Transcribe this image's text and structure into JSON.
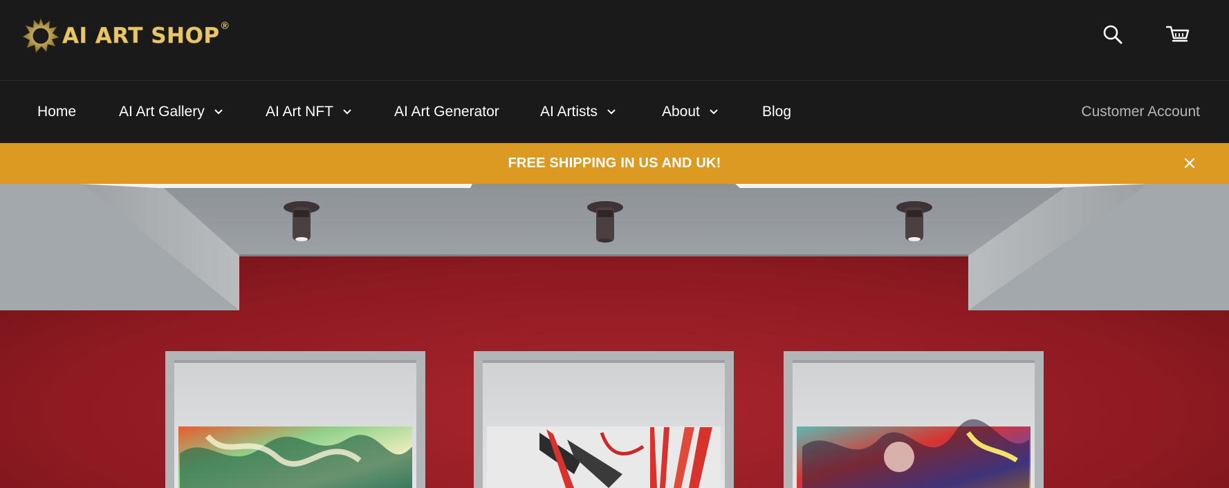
{
  "brand": {
    "name": "AI ART SHOP",
    "registered_mark": "®"
  },
  "header": {
    "icons": {
      "search": "search-icon",
      "cart": "cart-icon"
    }
  },
  "nav": {
    "items": [
      {
        "label": "Home",
        "has_dropdown": false
      },
      {
        "label": "AI Art Gallery",
        "has_dropdown": true
      },
      {
        "label": "AI Art NFT",
        "has_dropdown": true
      },
      {
        "label": "AI Art Generator",
        "has_dropdown": false
      },
      {
        "label": "AI Artists",
        "has_dropdown": true
      },
      {
        "label": "About",
        "has_dropdown": true
      },
      {
        "label": "Blog",
        "has_dropdown": false
      }
    ],
    "account_label": "Customer Account"
  },
  "announcement": {
    "text": "FREE SHIPPING IN US AND UK!",
    "background": "#dc9a22",
    "close_icon": "close-icon"
  },
  "colors": {
    "header_bg": "#1a1a1a",
    "brand_gold": "#e9c56b",
    "nav_text": "#ffffff",
    "account_text": "#b6b6b6",
    "gallery_wall": "#8f1a22"
  },
  "hero": {
    "description_icon": "gallery-wall-image",
    "spotlights": 3,
    "frames": 3
  }
}
